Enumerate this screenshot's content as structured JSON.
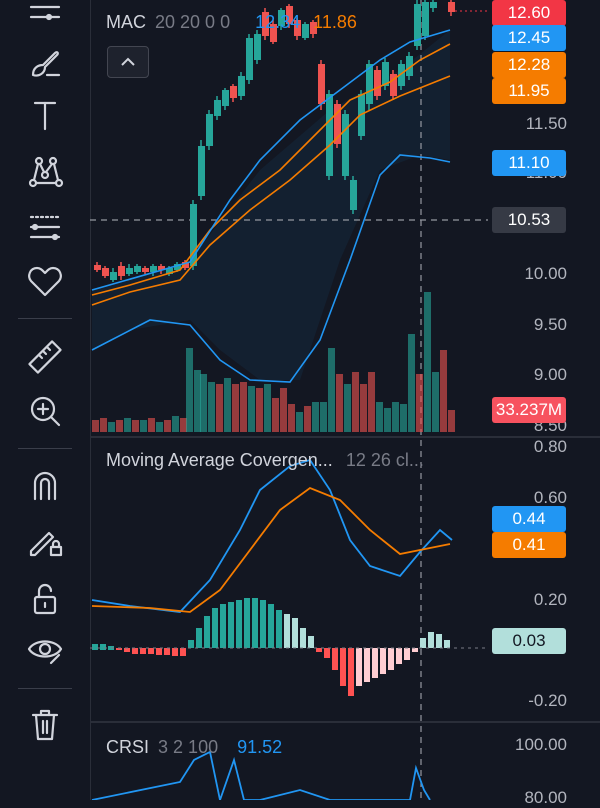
{
  "main_pane": {
    "indicator_name": "MAC",
    "indicator_params": "20 20 0 0",
    "value_blue": "12.34",
    "value_orange": "11.86",
    "axis_labels": [
      "11.50",
      "11.00",
      "10.00",
      "9.50",
      "9.00",
      "8.50"
    ],
    "tags": [
      {
        "text": "12.60",
        "color": "#f23645"
      },
      {
        "text": "12.45",
        "color": "#2196f3"
      },
      {
        "text": "12.28",
        "color": "#f57c00"
      },
      {
        "text": "11.95",
        "color": "#f57c00"
      },
      {
        "text": "11.10",
        "color": "#2196f3"
      },
      {
        "text": "10.53",
        "color": "#363a45"
      },
      {
        "text": "33.237M",
        "color": "#f7525f"
      }
    ]
  },
  "macd_pane": {
    "title": "Moving Average Covergen...",
    "params": "12 26 cl...",
    "axis_labels": [
      "0.80",
      "0.60",
      "0.20",
      "-0.20"
    ],
    "tags": [
      {
        "text": "0.44",
        "color": "#2196f3"
      },
      {
        "text": "0.41",
        "color": "#f57c00"
      },
      {
        "text": "0.03",
        "color": "#b2dfdb",
        "textColor": "#131722"
      }
    ]
  },
  "crsi_pane": {
    "title": "CRSI",
    "params": "3 2 100",
    "value": "91.52",
    "axis_labels": [
      "100.00",
      "80.00"
    ]
  },
  "toolbar_icons": [
    "menu-lines-icon",
    "brush-icon",
    "text-icon",
    "pattern-icon",
    "ruler-lines-icon",
    "heart-icon",
    "measure-ruler-icon",
    "zoom-in-icon",
    "magnet-icon",
    "lock-pencil-icon",
    "unlock-icon",
    "eye-icon",
    "trash-icon"
  ],
  "colors": {
    "up": "#26a69a",
    "down": "#ef5350",
    "blue": "#2196f3",
    "orange": "#f57c00",
    "bg": "#131722"
  }
}
